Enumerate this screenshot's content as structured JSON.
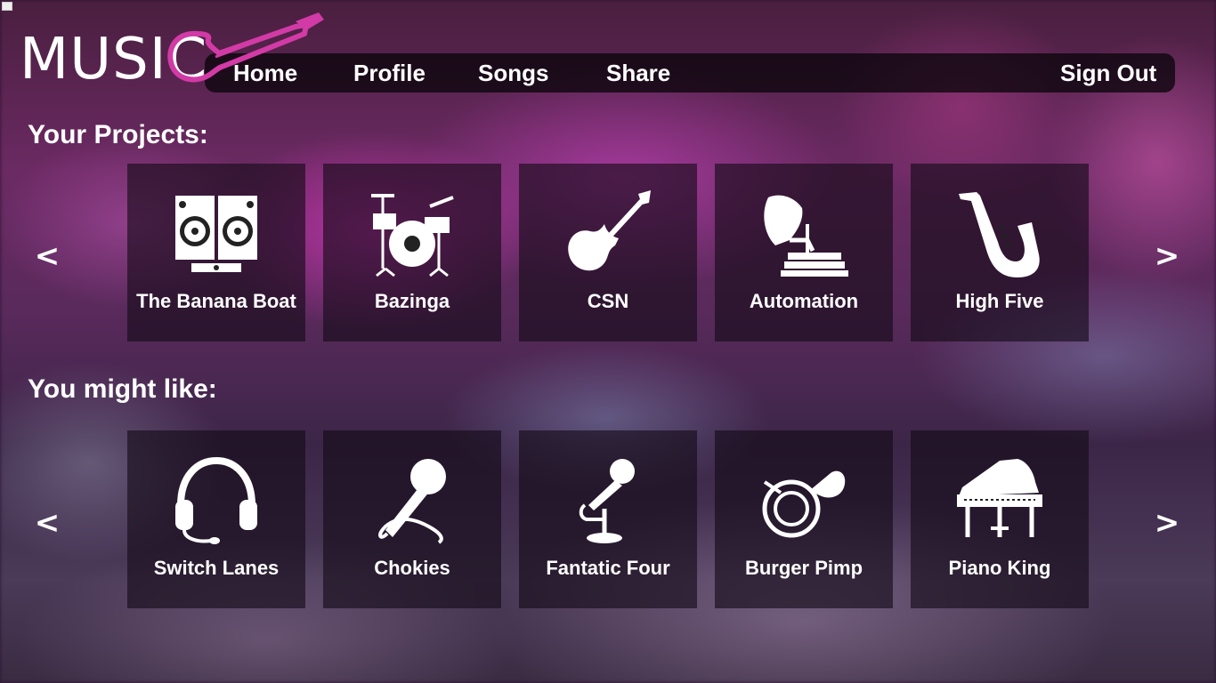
{
  "app": {
    "logo_text": "MUSIC"
  },
  "nav": {
    "home": "Home",
    "profile": "Profile",
    "songs": "Songs",
    "share": "Share",
    "sign_out": "Sign Out"
  },
  "sections": {
    "projects_title": "Your Projects:",
    "suggestions_title": "You might like:"
  },
  "arrows": {
    "prev": "<",
    "next": ">"
  },
  "projects": [
    {
      "title": "The Banana Boat",
      "icon": "speakers-icon"
    },
    {
      "title": "Bazinga",
      "icon": "drum-kit-icon"
    },
    {
      "title": "CSN",
      "icon": "electric-guitar-icon"
    },
    {
      "title": "Automation",
      "icon": "gramophone-icon"
    },
    {
      "title": "High Five",
      "icon": "saxophone-icon"
    }
  ],
  "suggestions": [
    {
      "title": "Switch Lanes",
      "icon": "headset-icon"
    },
    {
      "title": "Chokies",
      "icon": "microphone-icon"
    },
    {
      "title": "Fantatic Four",
      "icon": "mic-stand-icon"
    },
    {
      "title": "Burger Pimp",
      "icon": "french-horn-icon"
    },
    {
      "title": "Piano King",
      "icon": "grand-piano-icon"
    }
  ],
  "colors": {
    "accent": "#d23aa6",
    "tile_bg": "#140a16"
  }
}
